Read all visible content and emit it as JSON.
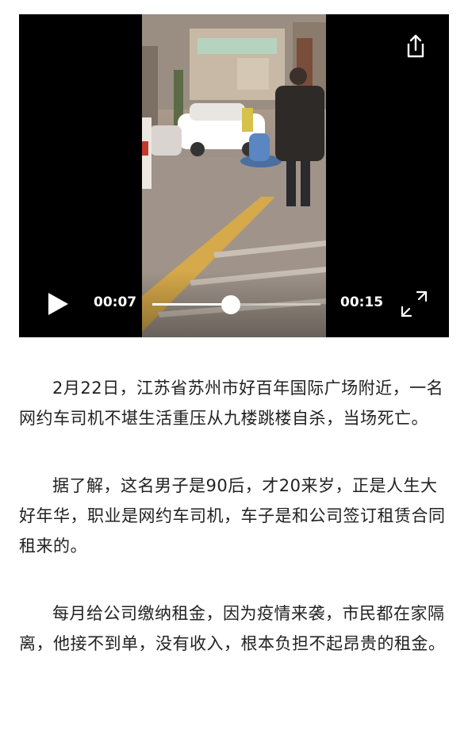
{
  "video": {
    "current_time": "00:07",
    "total_time": "00:15",
    "progress": 0.467
  },
  "icons": {
    "share": "share-icon",
    "play": "play-icon",
    "fullscreen": "fullscreen-icon"
  },
  "article": {
    "paragraphs": [
      "2月22日，江苏省苏州市好百年国际广场附近，一名网约车司机不堪生活重压从九楼跳楼自杀，当场死亡。",
      "据了解，这名男子是90后，才20来岁，正是人生大好年华，职业是网约车司机，车子是和公司签订租赁合同租来的。",
      "每月给公司缴纳租金，因为疫情来袭，市民都在家隔离，他接不到单，没有收入，根本负担不起昂贵的租金。"
    ]
  }
}
